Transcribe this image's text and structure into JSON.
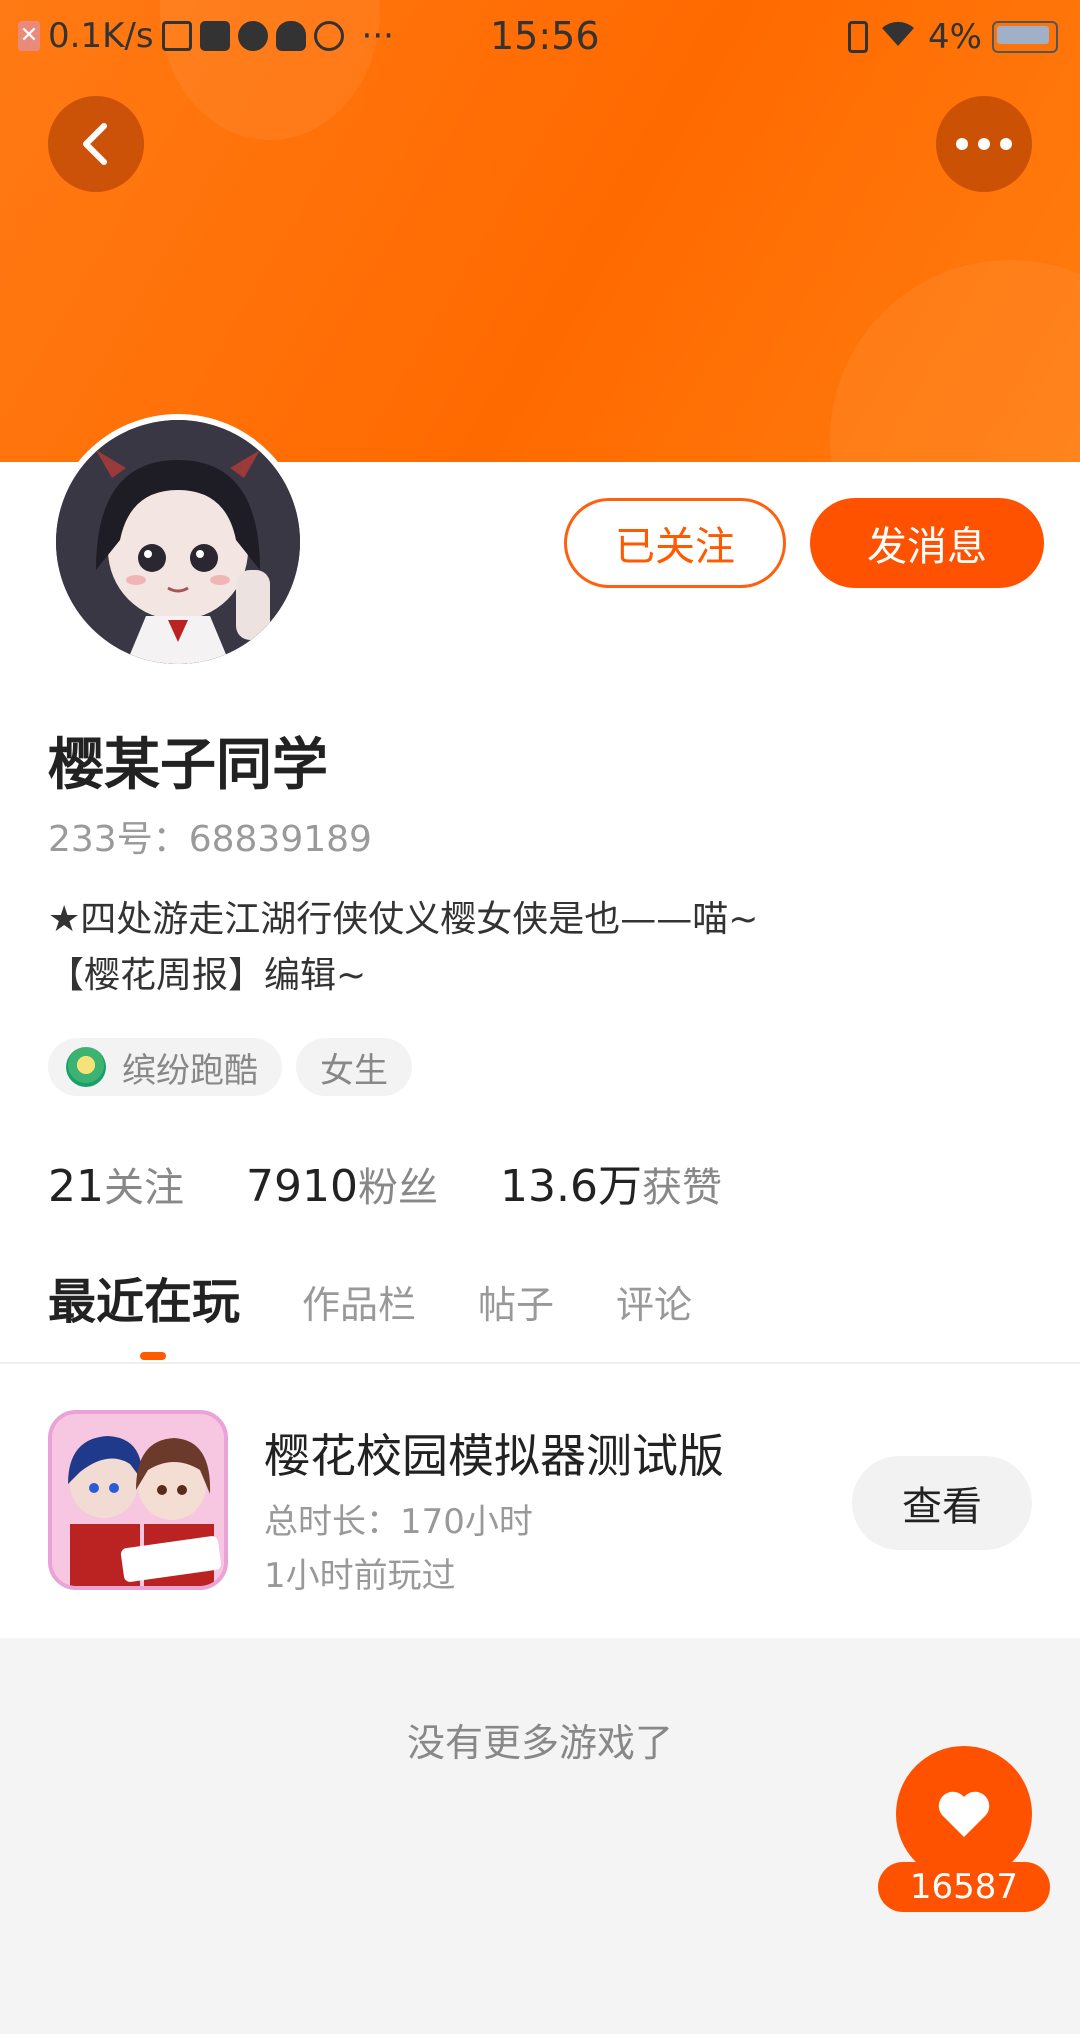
{
  "status_bar": {
    "network_speed": "0.1K/s",
    "time": "15:56",
    "battery": "4%",
    "more": "···"
  },
  "header": {
    "back_icon": "chevron-left-icon",
    "more_icon": "more-dots-icon"
  },
  "profile": {
    "name": "樱某子同学",
    "uid": "233号：68839189",
    "bio_line1": "★四处游走江湖行侠仗义樱女侠是也——喵~",
    "bio_line2": "【樱花周报】编辑~",
    "tags": [
      "缤纷跑酷",
      "女生"
    ],
    "followed_label": "已关注",
    "message_label": "发消息"
  },
  "stats": [
    {
      "value": "21",
      "label": "关注"
    },
    {
      "value": "7910",
      "label": "粉丝"
    },
    {
      "value": "13.6万",
      "label": "获赞"
    }
  ],
  "tabs": [
    "最近在玩",
    "作品栏",
    "帖子",
    "评论"
  ],
  "game": {
    "title": "樱花校园模拟器测试版",
    "duration": "总时长：170小时",
    "last_played": "1小时前玩过",
    "view_label": "查看",
    "icon_badge": "测试版"
  },
  "footer_text": "没有更多游戏了",
  "like": {
    "count": "16587"
  },
  "colors": {
    "accent": "#ff5200",
    "header_gradient_start": "#ff7a14",
    "header_gradient_end": "#ff7d10"
  }
}
